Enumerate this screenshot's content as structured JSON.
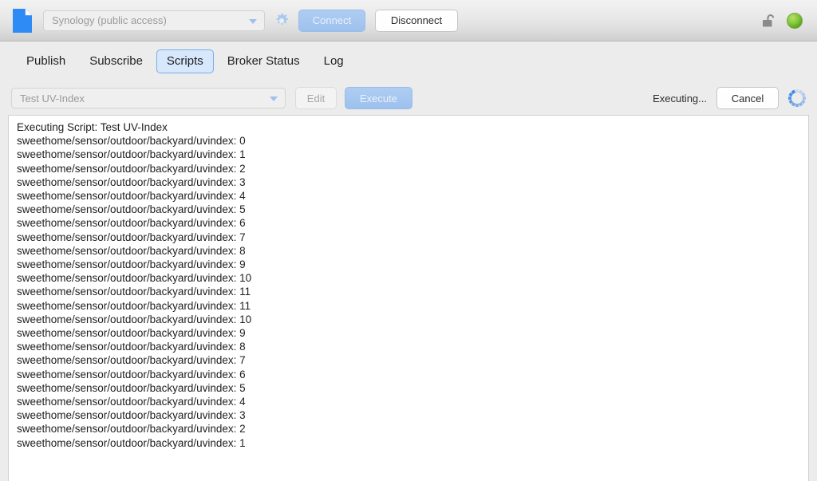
{
  "titlebar": {
    "doc_icon": "document-icon",
    "broker_select": {
      "value": "Synology (public access)",
      "placeholder": "Select broker",
      "arrow_icon": "chevron-down-icon"
    },
    "settings_icon": "gear-icon",
    "connect_label": "Connect",
    "disconnect_label": "Disconnect",
    "lock_icon": "unlocked-padlock-icon",
    "status_light": "connection-status-green",
    "accent_blue": "#9dc1ee",
    "status_green": "#86c83b"
  },
  "tabs": [
    {
      "label": "Publish",
      "selected": false
    },
    {
      "label": "Subscribe",
      "selected": false
    },
    {
      "label": "Scripts",
      "selected": true
    },
    {
      "label": "Broker Status",
      "selected": false
    },
    {
      "label": "Log",
      "selected": false
    }
  ],
  "scriptbar": {
    "script_select": {
      "value": "Test UV-Index",
      "placeholder": "Select script",
      "arrow_icon": "chevron-down-icon"
    },
    "edit_label": "Edit",
    "execute_label": "Execute",
    "executing_label": "Executing...",
    "cancel_label": "Cancel",
    "spinner_icon": "busy-spinner-icon"
  },
  "log": {
    "lines": [
      "Executing Script: Test UV-Index",
      "sweethome/sensor/outdoor/backyard/uvindex: 0",
      "sweethome/sensor/outdoor/backyard/uvindex: 1",
      "sweethome/sensor/outdoor/backyard/uvindex: 2",
      "sweethome/sensor/outdoor/backyard/uvindex: 3",
      "sweethome/sensor/outdoor/backyard/uvindex: 4",
      "sweethome/sensor/outdoor/backyard/uvindex: 5",
      "sweethome/sensor/outdoor/backyard/uvindex: 6",
      "sweethome/sensor/outdoor/backyard/uvindex: 7",
      "sweethome/sensor/outdoor/backyard/uvindex: 8",
      "sweethome/sensor/outdoor/backyard/uvindex: 9",
      "sweethome/sensor/outdoor/backyard/uvindex: 10",
      "sweethome/sensor/outdoor/backyard/uvindex: 11",
      "sweethome/sensor/outdoor/backyard/uvindex: 11",
      "sweethome/sensor/outdoor/backyard/uvindex: 10",
      "sweethome/sensor/outdoor/backyard/uvindex: 9",
      "sweethome/sensor/outdoor/backyard/uvindex: 8",
      "sweethome/sensor/outdoor/backyard/uvindex: 7",
      "sweethome/sensor/outdoor/backyard/uvindex: 6",
      "sweethome/sensor/outdoor/backyard/uvindex: 5",
      "sweethome/sensor/outdoor/backyard/uvindex: 4",
      "sweethome/sensor/outdoor/backyard/uvindex: 3",
      "sweethome/sensor/outdoor/backyard/uvindex: 2",
      "sweethome/sensor/outdoor/backyard/uvindex: 1"
    ]
  }
}
